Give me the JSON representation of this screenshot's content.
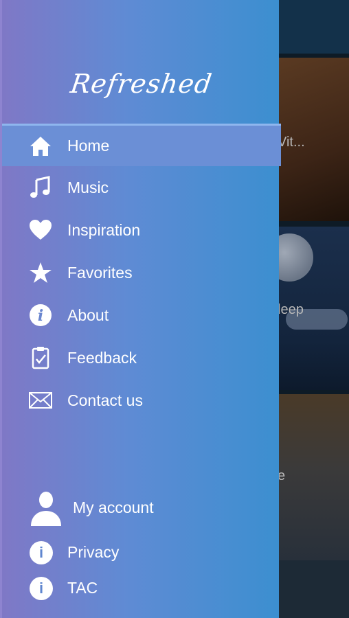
{
  "app": {
    "logo_text": "Refreshed"
  },
  "menu": {
    "items": [
      {
        "label": "Home",
        "icon": "home-icon",
        "active": true
      },
      {
        "label": "Music",
        "icon": "music-note-icon"
      },
      {
        "label": "Inspiration",
        "icon": "heart-icon"
      },
      {
        "label": "Favorites",
        "icon": "star-icon"
      },
      {
        "label": "About",
        "icon": "info-circle-icon"
      },
      {
        "label": "Feedback",
        "icon": "clipboard-check-icon"
      },
      {
        "label": "Contact us",
        "icon": "envelope-icon"
      }
    ]
  },
  "account": {
    "label": "My account",
    "icon": "person-icon"
  },
  "footer": {
    "items": [
      {
        "label": "Privacy",
        "icon": "info-icon"
      },
      {
        "label": "TAC",
        "icon": "info-icon"
      }
    ]
  },
  "background": {
    "cards": [
      {
        "title_fragment": "Vit..."
      },
      {
        "title_fragment": "leep"
      },
      {
        "title_fragment": "e"
      }
    ]
  },
  "colors": {
    "drawer_gradient_start": "#7f78c6",
    "drawer_gradient_end": "#3c8fd0",
    "active_item": "#6b8fd6"
  }
}
